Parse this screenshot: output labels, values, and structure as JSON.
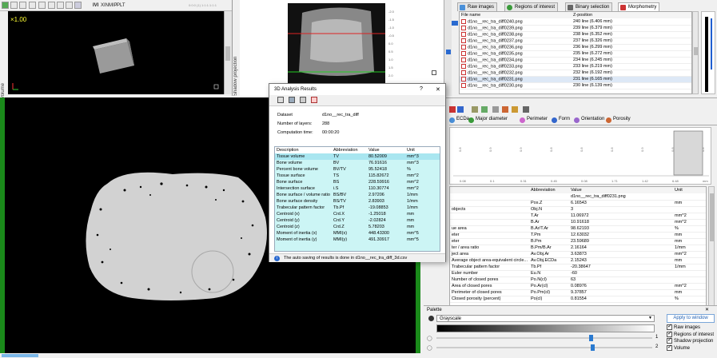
{
  "volume_view": {
    "zoom": "×1.00",
    "label": "Volume",
    "toolbar_modes": [
      "IVI",
      "XIN",
      "MIP",
      "PLT"
    ],
    "coords": "0:0:0 (1)  1:1:1:1:1:1"
  },
  "shadow_view": {
    "label": "Shadow projection",
    "ruler_ticks": [
      "-2.0",
      "-1.5",
      "-1.0",
      "-0.5",
      "0.0",
      "0.5",
      "1.0",
      "1.5",
      "2.0"
    ]
  },
  "files_panel": {
    "tabs": [
      {
        "label": "Raw images",
        "color": "#4a90d9"
      },
      {
        "label": "Regions of interest",
        "color": "#3a9a3a"
      },
      {
        "label": "Binary selection",
        "color": "#666666"
      },
      {
        "label": "Morphometry",
        "color": "#cc3333"
      }
    ],
    "columns": [
      "File name",
      "Z-position"
    ],
    "rows": [
      {
        "name": "d1no__rec_tra_diff0240.png",
        "z": "240 line (6.406 mm)"
      },
      {
        "name": "d1no__rec_tra_diff0239.png",
        "z": "239 line (6.379 mm)"
      },
      {
        "name": "d1no__rec_tra_diff0238.png",
        "z": "238 line (6.352 mm)"
      },
      {
        "name": "d1no__rec_tra_diff0237.png",
        "z": "237 line (6.326 mm)"
      },
      {
        "name": "d1no__rec_tra_diff0236.png",
        "z": "236 line (6.299 mm)"
      },
      {
        "name": "d1no__rec_tra_diff0235.png",
        "z": "235 line (6.272 mm)"
      },
      {
        "name": "d1no__rec_tra_diff0234.png",
        "z": "234 line (6.245 mm)"
      },
      {
        "name": "d1no__rec_tra_diff0233.png",
        "z": "233 line (6.219 mm)"
      },
      {
        "name": "d1no__rec_tra_diff0232.png",
        "z": "232 line (6.192 mm)"
      },
      {
        "name": "d1no__rec_tra_diff0231.png",
        "z": "231 line (6.165 mm)"
      },
      {
        "name": "d1no__rec_tra_diff0230.png",
        "z": "230 line (6.139 mm)"
      }
    ]
  },
  "morph_panel": {
    "tabs": [
      {
        "label": "ECDa",
        "color": "#4a90d9"
      },
      {
        "label": "Major diameter",
        "color": "#3a9a3a"
      },
      {
        "label": "Perimeter",
        "color": "#cc66cc"
      },
      {
        "label": "Form",
        "color": "#3366cc"
      },
      {
        "label": "Orientation",
        "color": "#9966cc"
      },
      {
        "label": "Porosity",
        "color": "#cc6633"
      }
    ],
    "histogram_x_ticks": [
      "0.08",
      "0.1",
      "0.31",
      "0.45",
      "0.08",
      "1.71",
      "1.42",
      "6.48",
      "mm"
    ],
    "histogram_y_ticks": [
      "0.8",
      "0.9",
      "0.9",
      "0.8",
      "0.8",
      "0.8",
      "0.9",
      "0.8",
      "0.8"
    ],
    "columns": [
      "",
      "Abbreviation",
      "Value",
      "Unit"
    ],
    "rows": [
      {
        "desc": "",
        "abbr": "",
        "value": "d1no__rec_tra_diff0231.png",
        "unit": ""
      },
      {
        "desc": "",
        "abbr": "Pos.Z",
        "value": "6.16543",
        "unit": "mm"
      },
      {
        "desc": "objects",
        "abbr": "Obj.N",
        "value": "3",
        "unit": ""
      },
      {
        "desc": "",
        "abbr": "T.Ar",
        "value": "11.06972",
        "unit": "mm^2"
      },
      {
        "desc": "",
        "abbr": "B.Ar",
        "value": "10.91618",
        "unit": "mm^2"
      },
      {
        "desc": "ue area",
        "abbr": "B.Ar/T.Ar",
        "value": "98.62193",
        "unit": "%"
      },
      {
        "desc": "eter",
        "abbr": "T.Pm",
        "value": "12.63032",
        "unit": "mm"
      },
      {
        "desc": "eter",
        "abbr": "B.Pm",
        "value": "23.59689",
        "unit": "mm"
      },
      {
        "desc": "ter / area ratio",
        "abbr": "B.Pm/B.Ar",
        "value": "2.16164",
        "unit": "1/mm"
      },
      {
        "desc": "ject area",
        "abbr": "Av.Obj.Ar",
        "value": "3.63873",
        "unit": "mm^2"
      },
      {
        "desc": "Average object area-equivalent circle...",
        "abbr": "Av.Obj.ECDa",
        "value": "2.15243",
        "unit": "mm"
      },
      {
        "desc": "Trabecular pattern factor",
        "abbr": "Tb.Pf",
        "value": "-20.38647",
        "unit": "1/mm"
      },
      {
        "desc": "Euler number",
        "abbr": "Eu.N",
        "value": "-60",
        "unit": ""
      },
      {
        "desc": "Number of closed pores",
        "abbr": "Po.N(cl)",
        "value": "63",
        "unit": ""
      },
      {
        "desc": "Area of closed pores",
        "abbr": "Po.Ar(cl)",
        "value": "0.08976",
        "unit": "mm^2"
      },
      {
        "desc": "Perimeter of closed pores",
        "abbr": "Po.Pm(cl)",
        "value": "9.37857",
        "unit": "mm"
      },
      {
        "desc": "Closed porosity (percent)",
        "abbr": "Po(cl)",
        "value": "0.81554",
        "unit": "%"
      }
    ]
  },
  "palette": {
    "title": "Palette",
    "selected": "Grayscale",
    "slider1_label": "1",
    "slider2_label": "2",
    "slider1_level": 0.72,
    "slider2_level": 0.73,
    "apply_button": "Apply to window",
    "checks": [
      "Raw images",
      "Regions of interest",
      "Shadow projection",
      "Volume"
    ]
  },
  "dialog": {
    "title": "3D Analysis Results",
    "help": "?",
    "close": "✕",
    "info": [
      {
        "label": "Dataset",
        "value": "d1no__rec_tra_diff"
      },
      {
        "label": "Number of layers:",
        "value": "288"
      },
      {
        "label": "Computation time:",
        "value": "00:00:20"
      }
    ],
    "columns": [
      "Description",
      "Abbreviation",
      "Value",
      "Unit"
    ],
    "rows": [
      {
        "desc": "Tissue volume",
        "abbr": "TV",
        "value": "80.52009",
        "unit": "mm^3"
      },
      {
        "desc": "Bone volume",
        "abbr": "BV",
        "value": "76.91616",
        "unit": "mm^3"
      },
      {
        "desc": "Percent bone volume",
        "abbr": "BV/TV",
        "value": "95.52418",
        "unit": "%"
      },
      {
        "desc": "Tissue surface",
        "abbr": "TS",
        "value": "115.82672",
        "unit": "mm^2"
      },
      {
        "desc": "Bone surface",
        "abbr": "BS",
        "value": "228.59916",
        "unit": "mm^2"
      },
      {
        "desc": "Intersection surface",
        "abbr": "i.S",
        "value": "110.30774",
        "unit": "mm^2"
      },
      {
        "desc": "Bone surface / volume ratio",
        "abbr": "BS/BV",
        "value": "2.97206",
        "unit": "1/mm"
      },
      {
        "desc": "Bone surface density",
        "abbr": "BS/TV",
        "value": "2.83903",
        "unit": "1/mm"
      },
      {
        "desc": "Trabecular pattern factor",
        "abbr": "Tb.Pf",
        "value": "-19.08853",
        "unit": "1/mm"
      },
      {
        "desc": "Centroid (x)",
        "abbr": "Crd.X",
        "value": "-1.25018",
        "unit": "mm"
      },
      {
        "desc": "Centroid (y)",
        "abbr": "Crd.Y",
        "value": "-2.02824",
        "unit": "mm"
      },
      {
        "desc": "Centroid (z)",
        "abbr": "Crd.Z",
        "value": "5.78203",
        "unit": "mm"
      },
      {
        "desc": "Moment of inertia (x)",
        "abbr": "MMI(x)",
        "value": "448.43300",
        "unit": "mm^5"
      },
      {
        "desc": "Moment of inertia (y)",
        "abbr": "MMI(y)",
        "value": "491.30917",
        "unit": "mm^5"
      }
    ],
    "status": "The auto saving of results is done in d1no__rec_tra_diff_3d.csv"
  }
}
